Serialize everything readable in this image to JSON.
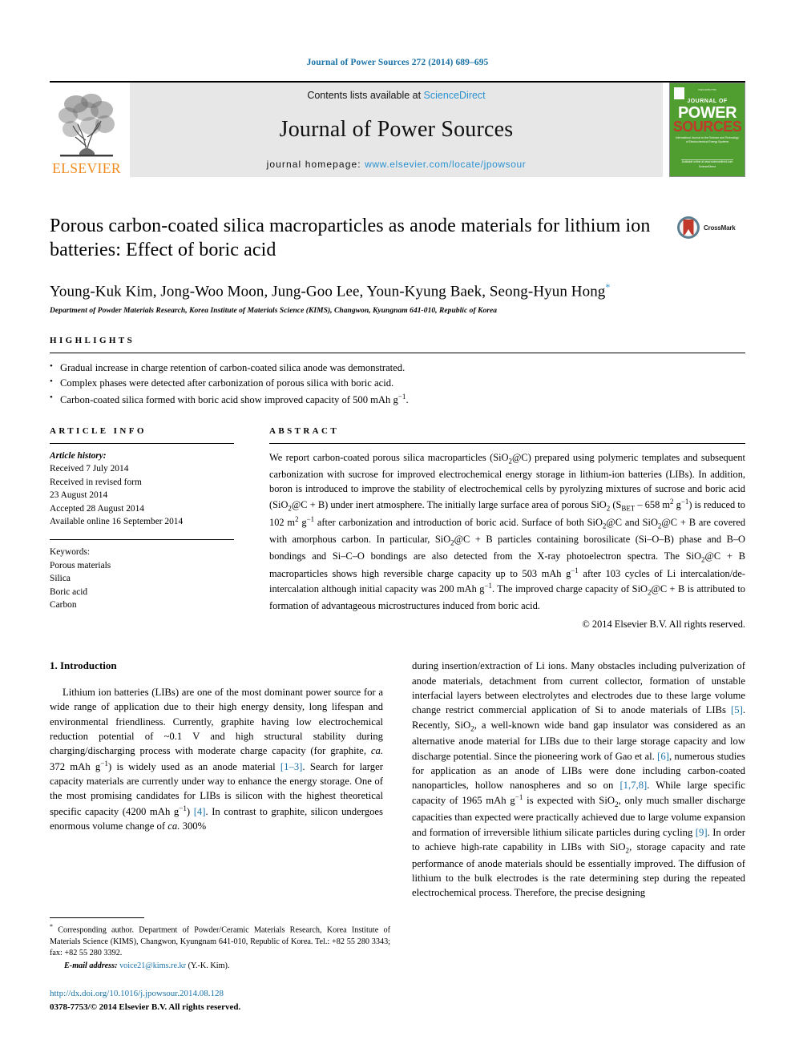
{
  "running_head": "Journal of Power Sources 272 (2014) 689–695",
  "masthead": {
    "publisher_name": "ELSEVIER",
    "contents_prefix": "Contents lists available at ",
    "contents_link": "ScienceDirect",
    "journal_title": "Journal of Power Sources",
    "homepage_prefix": "journal homepage: ",
    "homepage_url": "www.elsevier.com/locate/jpowsour",
    "cover": {
      "line1": "JOURNAL OF",
      "line2": "POWER",
      "line3": "SOURCES",
      "subtitle": "International Journal on the Science and Technology of Electrochemical Energy Systems",
      "footer": "Available online at www.sciencedirect.com  ScienceDirect"
    }
  },
  "article": {
    "title": "Porous carbon-coated silica macroparticles as anode materials for lithium ion batteries: Effect of boric acid",
    "authors": "Young-Kuk Kim, Jong-Woo Moon, Jung-Goo Lee, Youn-Kyung Baek, Seong-Hyun Hong",
    "corresponding_marker": "*",
    "affiliation": "Department of Powder Materials Research, Korea Institute of Materials Science (KIMS), Changwon, Kyungnam 641-010, Republic of Korea",
    "crossmark_label": "CrossMark"
  },
  "highlights": {
    "label": "HIGHLIGHTS",
    "items": [
      "Gradual increase in charge retention of carbon-coated silica anode was demonstrated.",
      "Complex phases were detected after carbonization of porous silica with boric acid.",
      "Carbon-coated silica formed with boric acid show improved capacity of 500 mAh g⁻¹."
    ]
  },
  "article_info": {
    "label": "ARTICLE INFO",
    "history_label": "Article history:",
    "history": [
      "Received 7 July 2014",
      "Received in revised form",
      "23 August 2014",
      "Accepted 28 August 2014",
      "Available online 16 September 2014"
    ],
    "keywords_label": "Keywords:",
    "keywords": [
      "Porous materials",
      "Silica",
      "Boric acid",
      "Carbon"
    ]
  },
  "abstract": {
    "label": "ABSTRACT",
    "paragraph_1": "We report carbon-coated porous silica macroparticles (SiO",
    "text_full": "We report carbon-coated porous silica macroparticles (SiO2@C) prepared using polymeric templates and subsequent carbonization with sucrose for improved electrochemical energy storage in lithium-ion batteries (LIBs). In addition, boron is introduced to improve the stability of electrochemical cells by pyrolyzing mixtures of sucrose and boric acid (SiO2@C + B) under inert atmosphere. The initially large surface area of porous SiO2 (SBET ~ 658 m2 g-1) is reduced to 102 m2 g-1 after carbonization and introduction of boric acid. Surface of both SiO2@C and SiO2@C + B are covered with amorphous carbon. In particular, SiO2@C + B particles containing borosilicate (Si-O-B) phase and B-O bondings and Si-C-O bondings are also detected from the X-ray photoelectron spectra. The SiO2@C + B macroparticles shows high reversible charge capacity up to 503 mAh g-1 after 103 cycles of Li intercalation/de-intercalation although initial capacity was 200 mAh g-1. The improved charge capacity of SiO2@C + B is attributed to formation of advantageous microstructures induced from boric acid.",
    "copyright": "© 2014 Elsevier B.V. All rights reserved."
  },
  "introduction": {
    "heading": "1.  Introduction",
    "left_text": "Lithium ion batteries (LIBs) are one of the most dominant power source for a wide range of application due to their high energy density, long lifespan and environmental friendliness. Currently, graphite having low electrochemical reduction potential of ~0.1 V and high structural stability during charging/discharging process with moderate charge capacity (for graphite, ca. 372 mAh g-1) is widely used as an anode material [1-3]. Search for larger capacity materials are currently under way to enhance the energy storage. One of the most promising candidates for LIBs is silicon with the highest theoretical specific capacity (4200 mAh g-1) [4]. In contrast to graphite, silicon undergoes enormous volume change of ca. 300%",
    "right_text": "during insertion/extraction of Li ions. Many obstacles including pulverization of anode materials, detachment from current collector, formation of unstable interfacial layers between electrolytes and electrodes due to these large volume change restrict commercial application of Si to anode materials of LIBs [5]. Recently, SiO2, a well-known wide band gap insulator was considered as an alternative anode material for LIBs due to their large storage capacity and low discharge potential. Since the pioneering work of Gao et al. [6], numerous studies for application as an anode of LIBs were done including carbon-coated nanoparticles, hollow nanospheres and so on [1,7,8]. While large specific capacity of 1965 mAh g-1 is expected with SiO2, only much smaller discharge capacities than expected were practically achieved due to large volume expansion and formation of irreversible lithium silicate particles during cycling [9]. In order to achieve high-rate capability in LIBs with SiO2, storage capacity and rate performance of anode materials should be essentially improved. The diffusion of lithium to the bulk electrodes is the rate determining step during the repeated electrochemical process. Therefore, the precise designing"
  },
  "footnote": {
    "corresponding": "Corresponding author. Department of Powder/Ceramic Materials Research, Korea Institute of Materials Science (KIMS), Changwon, Kyungnam 641-010, Republic of Korea. Tel.: +82 55 280 3343; fax: +82 55 280 3392.",
    "email_label": "E-mail address:",
    "email": "voice21@kims.re.kr",
    "email_owner": "(Y.-K. Kim).",
    "doi": "http://dx.doi.org/10.1016/j.jpowsour.2014.08.128",
    "issn": "0378-7753/© 2014 Elsevier B.V. All rights reserved."
  },
  "colors": {
    "link_blue": "#1a73a8",
    "sd_blue": "#2b92cf",
    "elsevier_orange": "#f08a1d",
    "cover_green": "#4f9e2f",
    "cover_red": "#c0392b",
    "banner_gray": "#e7e7e7"
  }
}
